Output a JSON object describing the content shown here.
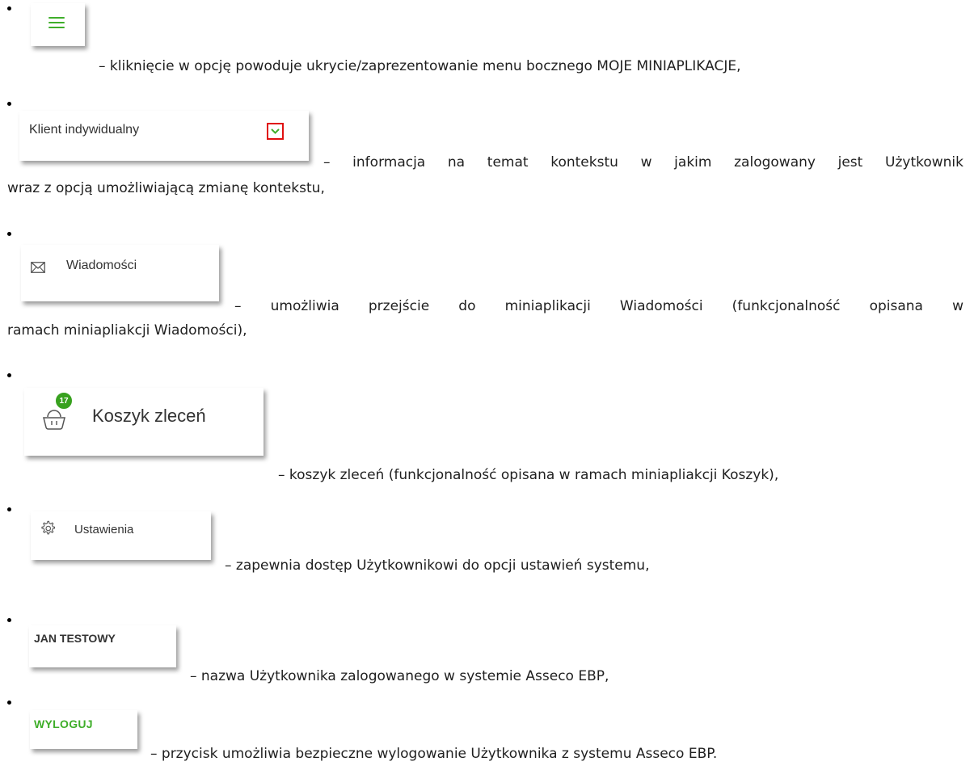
{
  "items": [
    {
      "id": "menu-toggle",
      "description": "– kliknięcie w opcję powoduje ukrycie/zaprezentowanie menu bocznego MOJE MINIAPLIKACJE,",
      "icon": "hamburger-menu-icon"
    },
    {
      "id": "context",
      "label": "Klient indywidualny",
      "description_line1": "– informacja na temat kontekstu w jakim zalogowany jest Użytkownik",
      "description_line2": "wraz z opcją umożliwiającą zmianę kontekstu,",
      "icon": "chevron-down-icon"
    },
    {
      "id": "messages",
      "label": "Wiadomości",
      "description_line1": "– umożliwia przejście do miniaplikacji Wiadomości (funkcjonalność opisana w",
      "description_line2": "ramach miniapliakcji Wiadomości),",
      "icon": "envelope-icon"
    },
    {
      "id": "basket",
      "label": "Koszyk zleceń",
      "badge": "17",
      "description": "– koszyk zleceń (funkcjonalność opisana w ramach miniapliakcji Koszyk),",
      "icon": "basket-icon"
    },
    {
      "id": "settings",
      "label": "Ustawienia",
      "description": "– zapewnia dostęp Użytkownikowi do opcji ustawień systemu,",
      "icon": "gear-icon"
    },
    {
      "id": "user",
      "label": "JAN TESTOWY",
      "description": "– nazwa Użytkownika zalogowanego w systemie Asseco EBP,"
    },
    {
      "id": "logout",
      "label": "WYLOGUJ",
      "description": "– przycisk umożliwia bezpieczne wylogowanie Użytkownika z systemu Asseco EBP."
    }
  ],
  "colors": {
    "accent_green": "#3fae2a",
    "badge_green": "#38a11f",
    "highlight_red": "#e01010",
    "text": "#1f1f1f"
  }
}
